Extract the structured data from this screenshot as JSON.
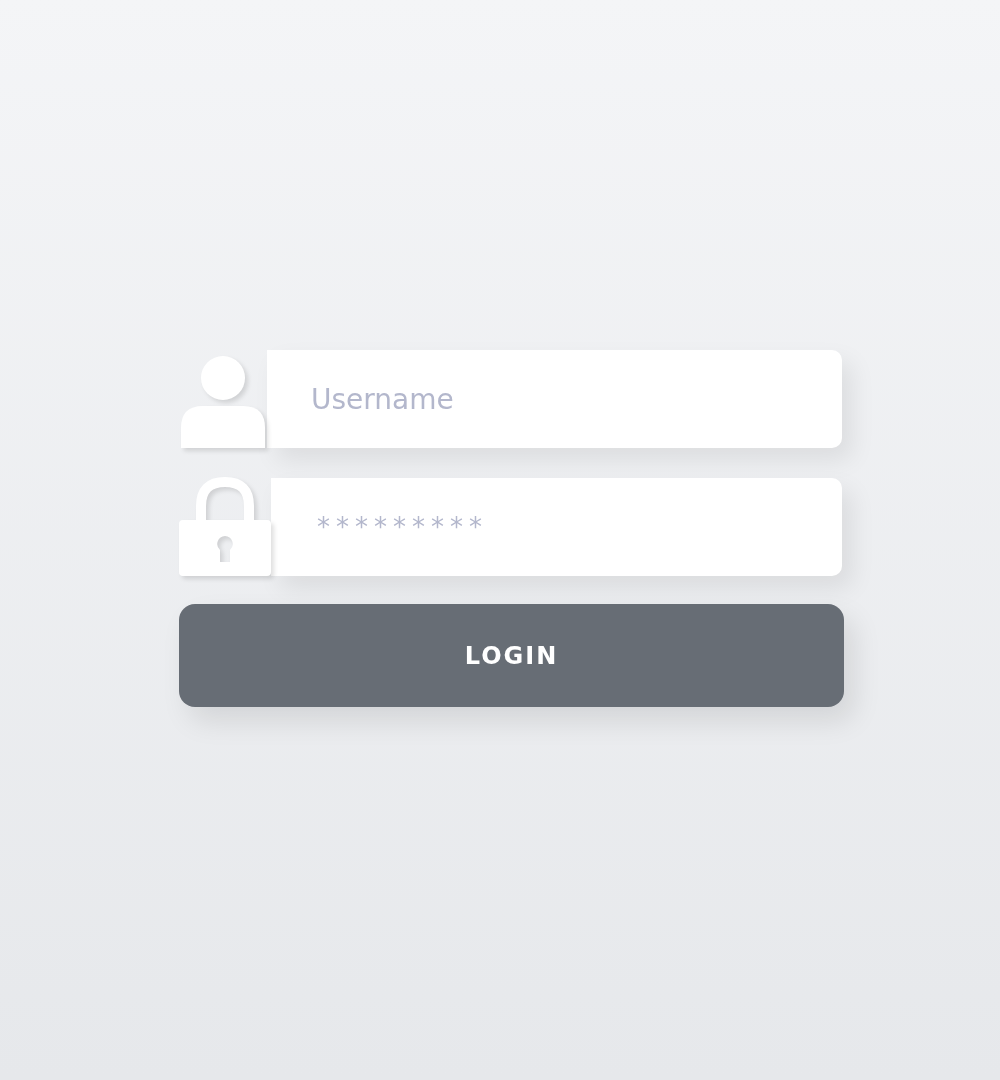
{
  "username_field": {
    "placeholder": "Username"
  },
  "password_field": {
    "value": "*********"
  },
  "login_button": {
    "label": "LOGIN"
  }
}
